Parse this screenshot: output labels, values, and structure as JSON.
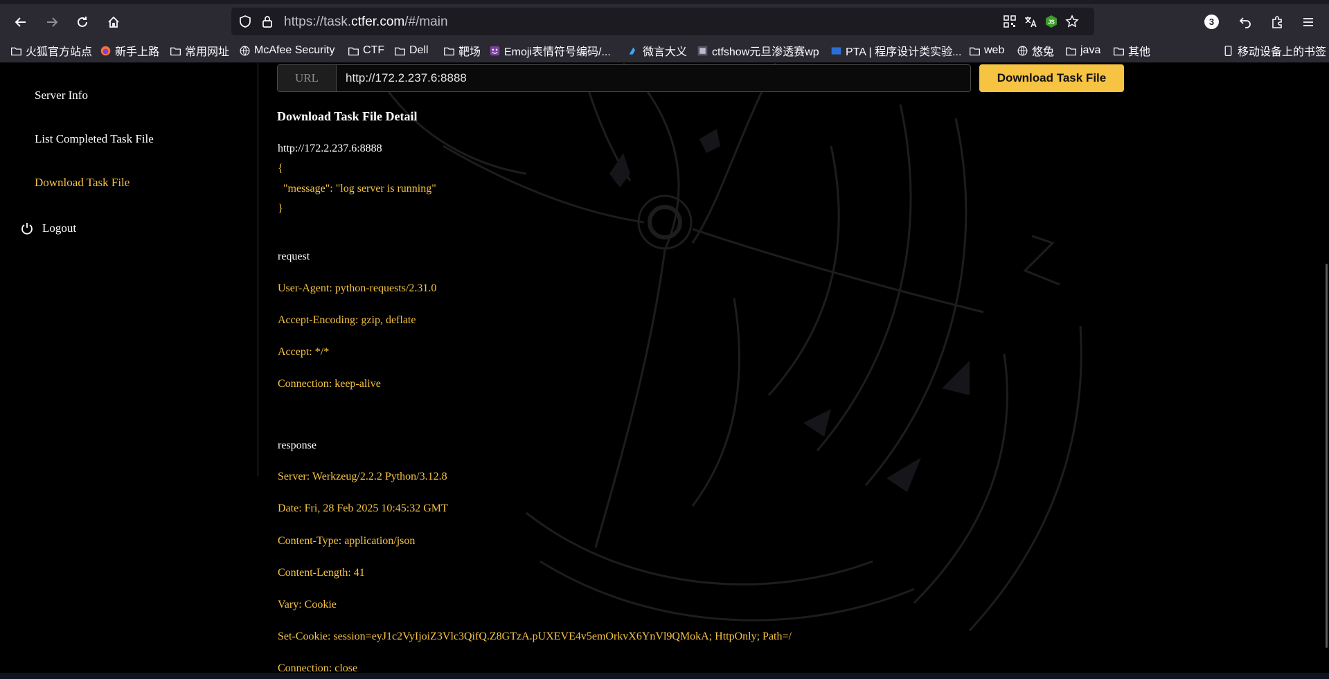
{
  "browser": {
    "url_prefix": "https://task.",
    "url_domain": "ctfer.com",
    "url_suffix": "/#/main",
    "extensions_count": "3"
  },
  "bookmarks": [
    {
      "label": "火狐官方站点",
      "icon": "folder-icon"
    },
    {
      "label": "新手上路",
      "icon": "firefox-icon"
    },
    {
      "label": "常用网址",
      "icon": "folder-icon"
    },
    {
      "label": "McAfee Security",
      "icon": "globe-icon"
    },
    {
      "label": "CTF",
      "icon": "folder-icon"
    },
    {
      "label": "Dell",
      "icon": "folder-icon"
    },
    {
      "label": "靶场",
      "icon": "folder-icon"
    },
    {
      "label": "Emoji表情符号编码/...",
      "icon": "emoji-site-icon"
    },
    {
      "label": "微言大义",
      "icon": "site-icon"
    },
    {
      "label": "ctfshow元旦渗透赛wp",
      "icon": "site-icon"
    },
    {
      "label": "PTA | 程序设计类实验...",
      "icon": "site-icon"
    },
    {
      "label": "web",
      "icon": "folder-icon"
    },
    {
      "label": "悠兔",
      "icon": "globe-icon"
    },
    {
      "label": "java",
      "icon": "folder-icon"
    },
    {
      "label": "其他",
      "icon": "folder-icon"
    },
    {
      "label": "移动设备上的书签",
      "icon": "mobile-icon"
    }
  ],
  "sidebar": {
    "items": [
      {
        "label": "Server Info"
      },
      {
        "label": "List Completed Task File"
      },
      {
        "label": "Download Task File",
        "active": true
      }
    ],
    "logout_label": "Logout"
  },
  "form": {
    "addon_label": "URL",
    "url_value": "http://172.2.237.6:8888",
    "submit_label": "Download Task File"
  },
  "detail": {
    "title": "Download Task File Detail",
    "target_url": "http://172.2.237.6:8888",
    "body_lines": [
      "{",
      "  \"message\": \"log server is running\"",
      "}"
    ],
    "request_label": "request",
    "request_headers": [
      "User-Agent: python-requests/2.31.0",
      "Accept-Encoding: gzip, deflate",
      "Accept: */*",
      "Connection: keep-alive"
    ],
    "response_label": "response",
    "response_headers": [
      "Server: Werkzeug/2.2.2 Python/3.12.8",
      "Date: Fri, 28 Feb 2025 10:45:32 GMT",
      "Content-Type: application/json",
      "Content-Length: 41",
      "Vary: Cookie",
      "Set-Cookie: session=eyJ1c2VyIjoiZ3Vlc3QifQ.Z8GTzA.pUXEVE4v5emOrkvX6YnVl9QMokA; HttpOnly; Path=/",
      "Connection: close"
    ]
  },
  "colors": {
    "accent": "#f6c342",
    "background": "#000000",
    "chrome": "#2b2a33"
  }
}
